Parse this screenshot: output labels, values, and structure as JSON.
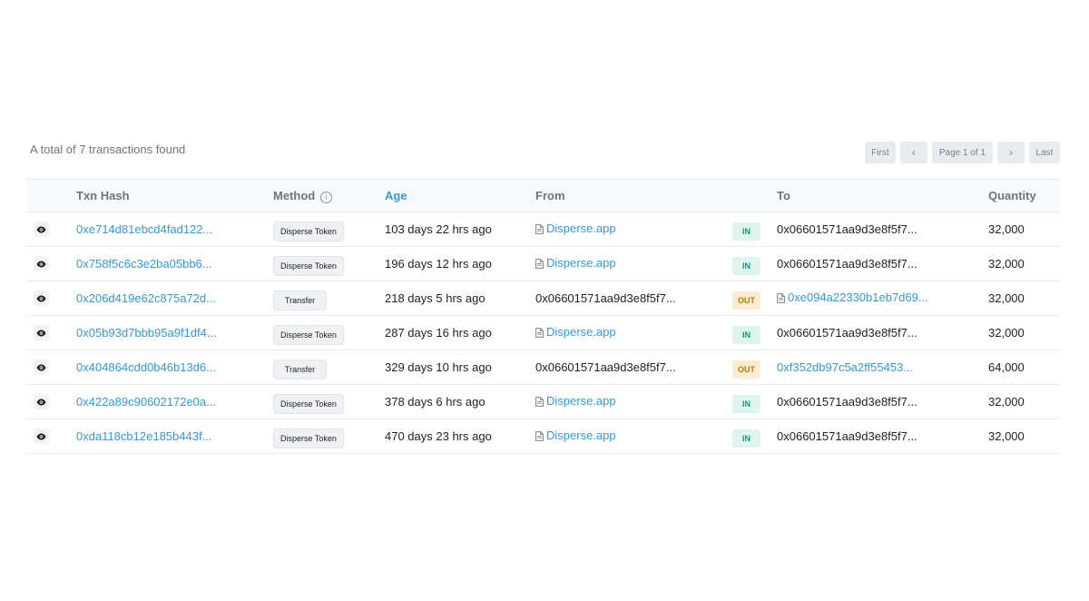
{
  "summary": "A total of 7 transactions found",
  "pager": {
    "first": "First",
    "prev": "‹",
    "page": "Page 1 of 1",
    "next": "›",
    "last": "Last"
  },
  "columns": {
    "txn_hash": "Txn Hash",
    "method": "Method",
    "method_info": "i",
    "age": "Age",
    "from": "From",
    "to": "To",
    "quantity": "Quantity"
  },
  "rows": [
    {
      "hash": "0xe714d81ebcd4fad122...",
      "method": "Disperse Token",
      "age": "103 days 22 hrs ago",
      "from": "Disperse.app",
      "from_contract": true,
      "dir": "IN",
      "to": "0x06601571aa9d3e8f5f7...",
      "to_link": false,
      "to_contract": false,
      "qty": "32,000"
    },
    {
      "hash": "0x758f5c6c3e2ba05bb6...",
      "method": "Disperse Token",
      "age": "196 days 12 hrs ago",
      "from": "Disperse.app",
      "from_contract": true,
      "dir": "IN",
      "to": "0x06601571aa9d3e8f5f7...",
      "to_link": false,
      "to_contract": false,
      "qty": "32,000"
    },
    {
      "hash": "0x206d419e62c875a72d...",
      "method": "Transfer",
      "age": "218 days 5 hrs ago",
      "from": "0x06601571aa9d3e8f5f7...",
      "from_contract": false,
      "dir": "OUT",
      "to": "0xe094a22330b1eb7d69...",
      "to_link": true,
      "to_contract": true,
      "qty": "32,000"
    },
    {
      "hash": "0x05b93d7bbb95a9f1df4...",
      "method": "Disperse Token",
      "age": "287 days 16 hrs ago",
      "from": "Disperse.app",
      "from_contract": true,
      "dir": "IN",
      "to": "0x06601571aa9d3e8f5f7...",
      "to_link": false,
      "to_contract": false,
      "qty": "32,000"
    },
    {
      "hash": "0x404864cdd0b46b13d6...",
      "method": "Transfer",
      "age": "329 days 10 hrs ago",
      "from": "0x06601571aa9d3e8f5f7...",
      "from_contract": false,
      "dir": "OUT",
      "to": "0xf352db97c5a2ff55453...",
      "to_link": true,
      "to_contract": false,
      "qty": "64,000"
    },
    {
      "hash": "0x422a89c90602172e0a...",
      "method": "Disperse Token",
      "age": "378 days 6 hrs ago",
      "from": "Disperse.app",
      "from_contract": true,
      "dir": "IN",
      "to": "0x06601571aa9d3e8f5f7...",
      "to_link": false,
      "to_contract": false,
      "qty": "32,000"
    },
    {
      "hash": "0xda118cb12e185b443f...",
      "method": "Disperse Token",
      "age": "470 days 23 hrs ago",
      "from": "Disperse.app",
      "from_contract": true,
      "dir": "IN",
      "to": "0x06601571aa9d3e8f5f7...",
      "to_link": false,
      "to_contract": false,
      "qty": "32,000"
    }
  ],
  "icons": {
    "view": "eye-icon",
    "contract": "document-icon",
    "info": "info-circle-icon"
  },
  "colors": {
    "link": "#3498db",
    "in_bg": "#def5ec",
    "in_text": "#00a186",
    "out_bg": "#fbeccf",
    "out_text": "#b47d00"
  }
}
